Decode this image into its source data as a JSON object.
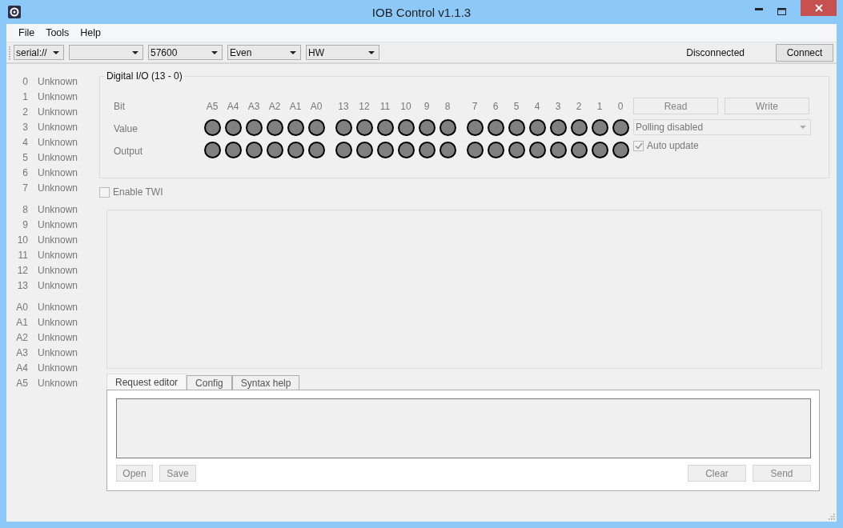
{
  "window": {
    "title": "IOB Control v1.1.3"
  },
  "menu": [
    "File",
    "Tools",
    "Help"
  ],
  "toolbar": {
    "combos": [
      {
        "kind": "scheme",
        "value": "serial://"
      },
      {
        "kind": "port"
      },
      {
        "kind": "baud",
        "value": "57600"
      },
      {
        "kind": "parity",
        "value": "Even"
      },
      {
        "kind": "flow",
        "value": "HW"
      }
    ],
    "status": "Disconnected",
    "connect_button": "Connect"
  },
  "pins": [
    {
      "items": [
        {
          "pin": "0",
          "state": "Unknown"
        },
        {
          "pin": "1",
          "state": "Unknown"
        },
        {
          "pin": "2",
          "state": "Unknown"
        },
        {
          "pin": "3",
          "state": "Unknown"
        },
        {
          "pin": "4",
          "state": "Unknown"
        },
        {
          "pin": "5",
          "state": "Unknown"
        },
        {
          "pin": "6",
          "state": "Unknown"
        },
        {
          "pin": "7",
          "state": "Unknown"
        }
      ]
    },
    {
      "items": [
        {
          "pin": "8",
          "state": "Unknown"
        },
        {
          "pin": "9",
          "state": "Unknown"
        },
        {
          "pin": "10",
          "state": "Unknown"
        },
        {
          "pin": "11",
          "state": "Unknown"
        },
        {
          "pin": "12",
          "state": "Unknown"
        },
        {
          "pin": "13",
          "state": "Unknown"
        }
      ]
    },
    {
      "items": [
        {
          "pin": "A0",
          "state": "Unknown"
        },
        {
          "pin": "A1",
          "state": "Unknown"
        },
        {
          "pin": "A2",
          "state": "Unknown"
        },
        {
          "pin": "A3",
          "state": "Unknown"
        },
        {
          "pin": "A4",
          "state": "Unknown"
        },
        {
          "pin": "A5",
          "state": "Unknown"
        }
      ]
    }
  ],
  "digital_io": {
    "title": "Digital I/O (13 - 0)",
    "row_labels": [
      "Bit",
      "Value",
      "Output"
    ],
    "bit_groups": [
      {
        "bits": [
          "A5",
          "A4",
          "A3",
          "A2",
          "A1",
          "A0"
        ]
      },
      {
        "bits": [
          "13",
          "12",
          "11",
          "10",
          "9",
          "8"
        ]
      },
      {
        "bits": [
          "7",
          "6",
          "5",
          "4",
          "3",
          "2",
          "1",
          "0"
        ]
      }
    ],
    "read_button": {
      "label": "Read",
      "disabled": true
    },
    "write_button": {
      "label": "Write",
      "disabled": true
    },
    "polling": {
      "value": "Polling disabled",
      "disabled": true
    },
    "auto_update": {
      "label": "Auto update",
      "checked": true,
      "disabled": true
    }
  },
  "enable_twi": {
    "label": "Enable TWI",
    "checked": false,
    "disabled": true
  },
  "tabs": [
    {
      "label": "Request editor",
      "selected": true
    },
    {
      "label": "Config",
      "selected": false
    },
    {
      "label": "Syntax help",
      "selected": false
    }
  ],
  "editor_buttons": [
    {
      "label": "Open",
      "disabled": true
    },
    {
      "label": "Save",
      "disabled": true
    },
    {
      "label": "Clear",
      "disabled": true
    },
    {
      "label": "Send",
      "disabled": true
    }
  ]
}
